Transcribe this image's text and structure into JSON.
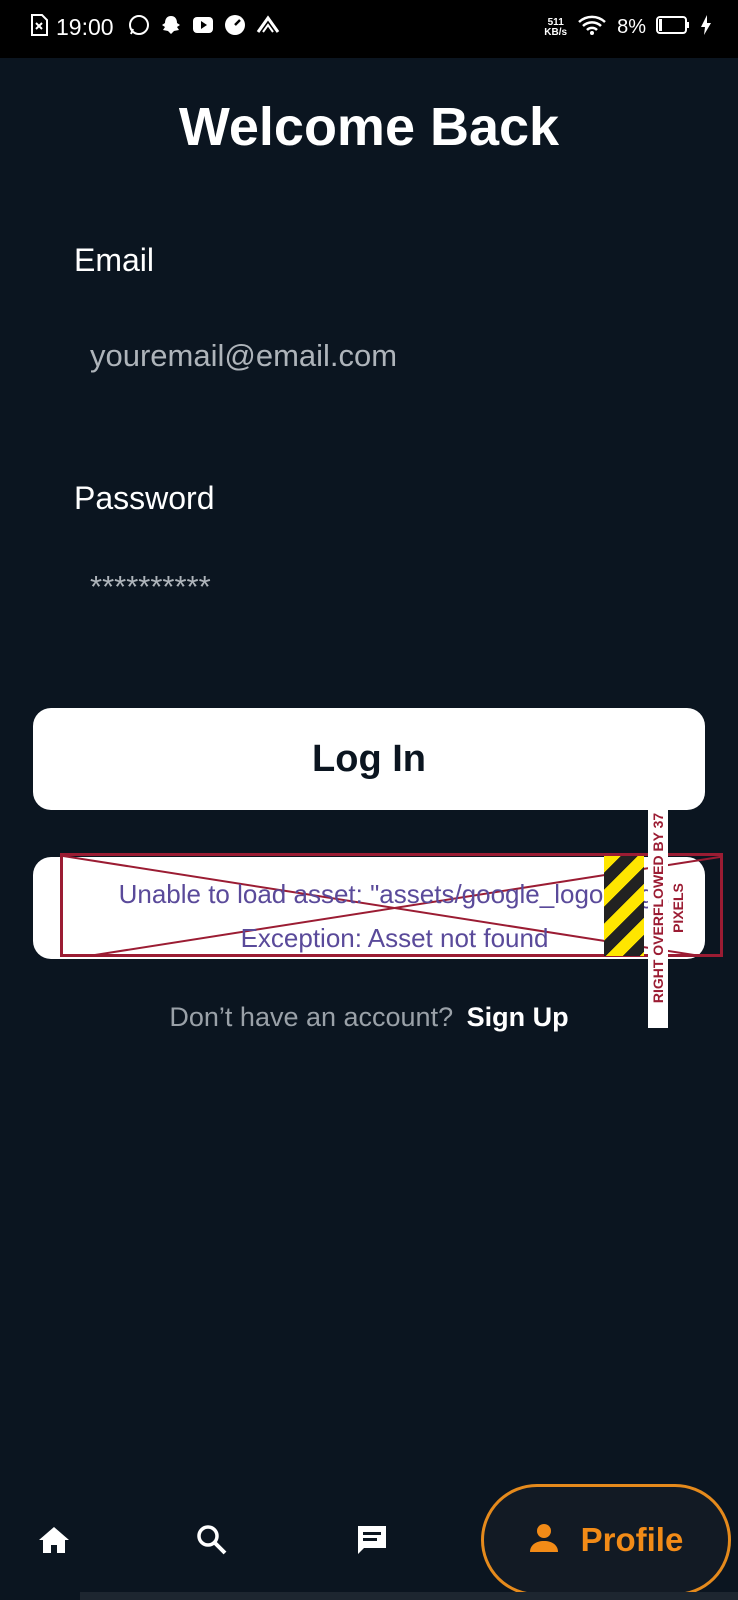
{
  "status_bar": {
    "time": "19:00",
    "net_speed_value": "511",
    "net_speed_unit": "KB/s",
    "battery": "8%",
    "left_icons": [
      "sim-icon",
      "whatsapp-icon",
      "snapchat-icon",
      "youtube-icon",
      "speedometer-icon",
      "app-icon"
    ]
  },
  "page": {
    "title": "Welcome Back"
  },
  "form": {
    "email_label": "Email",
    "email_placeholder": "youremail@email.com",
    "password_label": "Password",
    "password_placeholder": "**********",
    "login_label": "Log In"
  },
  "google_button": {
    "error_line1": "Unable to load asset: \"assets/google_logo.png\".",
    "error_line2": "Exception: Asset not found",
    "overflow_message": "RIGHT OVERFLOWED BY 37 PIXELS"
  },
  "signup": {
    "question": "Don’t have an account?",
    "link": "Sign Up"
  },
  "nav": {
    "items": [
      "home-icon",
      "search-icon",
      "chat-icon"
    ],
    "profile_label": "Profile",
    "active_color": "#f28b17"
  }
}
